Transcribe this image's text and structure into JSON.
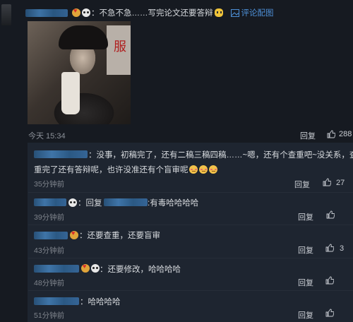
{
  "post": {
    "text": "：不急不急……写完论文还要答辩",
    "link": "评论配图",
    "time": "今天 15:34",
    "reply_label": "回复",
    "likes": "288",
    "photo_sign_char": "服"
  },
  "replies": [
    {
      "line1": "：没事，初稿完了，还有二稿三稿四稿……~嗯，还有个查重吧~没关系，查",
      "line2": "重完了还有答辩呢，也许没准还有个盲审呢",
      "time": "35分钟前",
      "reply_label": "回复",
      "likes": "27"
    },
    {
      "text_a": "：回复",
      "text_b": ":有毒哈哈哈哈",
      "time": "39分钟前",
      "reply_label": "回复",
      "likes": ""
    },
    {
      "text": "：还要查重，还要盲审",
      "time": "43分钟前",
      "reply_label": "回复",
      "likes": "3"
    },
    {
      "text": "：还要修改，哈哈哈哈",
      "time": "48分钟前",
      "reply_label": "回复",
      "likes": ""
    },
    {
      "text": "：哈哈哈哈",
      "time": "51分钟前",
      "reply_label": "回复",
      "likes": ""
    }
  ],
  "colors": {
    "background": "#161a21",
    "reply_panel": "#1e2530",
    "link": "#4d8fd6"
  },
  "icons": [
    "heart-emoji-icon",
    "panda-emoji-icon",
    "cat-emoji-icon",
    "shy-emoji-icon",
    "image-icon",
    "thumbs-up-icon"
  ]
}
